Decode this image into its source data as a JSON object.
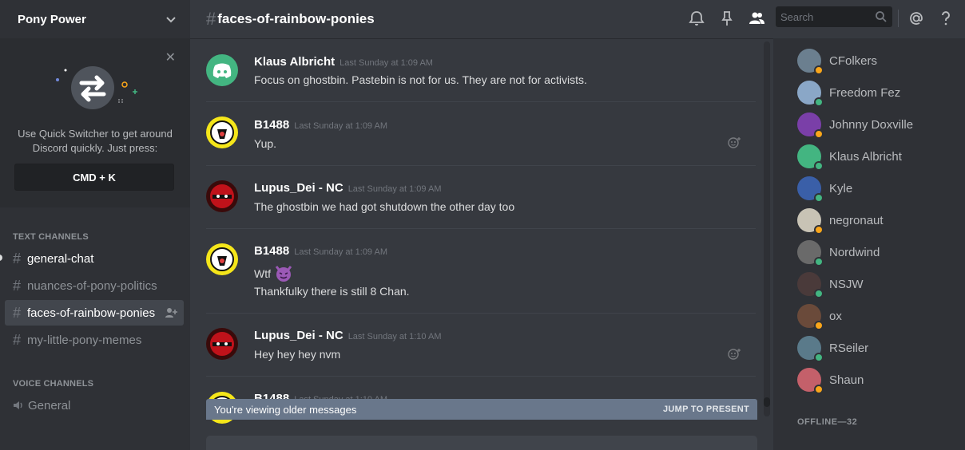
{
  "server": {
    "name": "Pony Power"
  },
  "quick_switcher": {
    "text": "Use Quick Switcher to get around Discord quickly. Just press:",
    "shortcut": "CMD + K"
  },
  "sidebar": {
    "text_channels_header": "TEXT CHANNELS",
    "voice_channels_header": "VOICE CHANNELS",
    "text_channels": [
      {
        "name": "general-chat",
        "state": "unread"
      },
      {
        "name": "nuances-of-pony-politics",
        "state": "normal"
      },
      {
        "name": "faces-of-rainbow-ponies",
        "state": "active"
      },
      {
        "name": "my-little-pony-memes",
        "state": "normal"
      }
    ],
    "voice_channels": [
      {
        "name": "General"
      }
    ]
  },
  "header": {
    "channel": "faces-of-rainbow-ponies",
    "search_placeholder": "Search",
    "icons": [
      "bell-icon",
      "pin-icon",
      "members-icon",
      "search-icon",
      "mention-icon",
      "help-icon"
    ]
  },
  "messages": [
    {
      "author": "Klaus Albricht",
      "timestamp": "Last Sunday at 1:09 AM",
      "lines": [
        "Focus on ghostbin. Pastebin is not for us. They are not for activists."
      ],
      "avatar": "discord-default"
    },
    {
      "author": "B1488",
      "timestamp": "Last Sunday at 1:09 AM",
      "lines": [
        "Yup."
      ],
      "avatar": "yellow-emblem"
    },
    {
      "author": "Lupus_Dei - NC",
      "timestamp": "Last Sunday at 1:09 AM",
      "lines": [
        "The ghostbin we had got shutdown the other day too"
      ],
      "avatar": "red-mask"
    },
    {
      "author": "B1488",
      "timestamp": "Last Sunday at 1:09 AM",
      "lines": [
        "Wtf",
        "Thankfulky there is still 8 Chan."
      ],
      "avatar": "yellow-emblem"
    },
    {
      "author": "Lupus_Dei - NC",
      "timestamp": "Last Sunday at 1:10 AM",
      "lines": [
        "Hey hey hey nvm"
      ],
      "avatar": "red-mask"
    },
    {
      "author": "B1488",
      "timestamp": "Last Sunday at 1:10 AM",
      "lines": [],
      "avatar": "yellow-emblem"
    }
  ],
  "older_bar": {
    "text": "You're viewing older messages",
    "action": "JUMP TO PRESENT"
  },
  "members": {
    "online": [
      {
        "name": "CFolkers",
        "status": "idle",
        "color": "#6b7f8f"
      },
      {
        "name": "Freedom Fez",
        "status": "online",
        "color": "#8aa7c7"
      },
      {
        "name": "Johnny Doxville",
        "status": "idle",
        "color": "#7a3fa8"
      },
      {
        "name": "Klaus Albricht",
        "status": "online",
        "color": "#43b581"
      },
      {
        "name": "Kyle",
        "status": "online",
        "color": "#3a5fa8"
      },
      {
        "name": "negronaut",
        "status": "idle",
        "color": "#c8c3b5"
      },
      {
        "name": "Nordwind",
        "status": "online",
        "color": "#6a6a6a"
      },
      {
        "name": "NSJW",
        "status": "online",
        "color": "#4a3a3a"
      },
      {
        "name": "ox",
        "status": "idle",
        "color": "#6a4a3a"
      },
      {
        "name": "RSeiler",
        "status": "online",
        "color": "#5a7a8a"
      },
      {
        "name": "Shaun",
        "status": "idle",
        "color": "#c4606a"
      }
    ],
    "offline_header": "OFFLINE—32"
  },
  "colors": {
    "online": "#43b581",
    "idle": "#faa61a",
    "blurple": "#7289da"
  }
}
